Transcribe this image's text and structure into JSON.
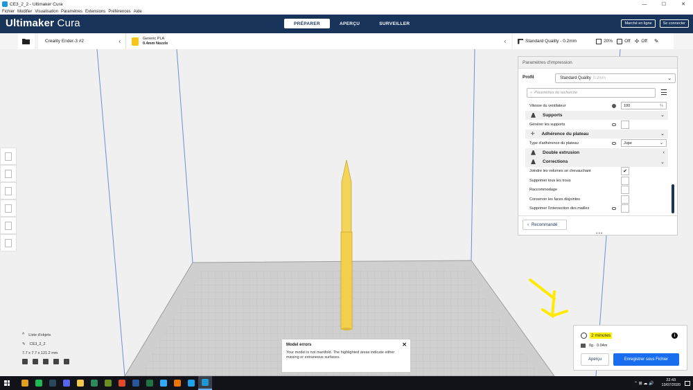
{
  "window": {
    "title": "CE3_2_2 - Ultimaker Cura",
    "controls": [
      "—",
      "☐",
      "✕"
    ]
  },
  "menu": [
    "Fichier",
    "Modifier",
    "Visualisation",
    "Paramètres",
    "Extensions",
    "Préférences",
    "Aide"
  ],
  "header": {
    "brand_bold": "Ultimaker",
    "brand_light": " Cura",
    "tabs": [
      {
        "label": "PRÉPARER",
        "active": true
      },
      {
        "label": "APERÇU",
        "active": false
      },
      {
        "label": "SURVEILLER",
        "active": false
      }
    ],
    "marketplace": "Marché en ligne",
    "signin": "Se connecter"
  },
  "stage": {
    "printer": "Creality Ender-3 #2",
    "material_name": "Generic PLA",
    "nozzle": "0.4mm Nozzle",
    "quality": "Standard Quality - 0.2mm",
    "infill": "20%",
    "support": "Off",
    "adhesion": "Off"
  },
  "panel": {
    "title": "Paramètres d'impression",
    "profile_label": "Profil",
    "profile_value": "Standard Quality",
    "profile_faded": "0.2mm",
    "search_placeholder": "Paramètres de recherche",
    "rows": {
      "fan_speed": {
        "label": "Vitesse du ventilateur",
        "value": "100",
        "unit": "%"
      },
      "supports": "Supports",
      "gen_supports": "Générer les supports",
      "adhesion": "Adhérence du plateau",
      "adhesion_type": {
        "label": "Type d'adhérence du plateau",
        "value": "Jupe"
      },
      "dual": "Double extrusion",
      "corrections": "Corrections",
      "union": "Joindre les volumes se chevauchant",
      "holes": "Supprimer tous les trous",
      "stitch": "Raccommodage",
      "disjoint": "Conserver les faces disjointes",
      "intersect": "Supprimer l'intersection des mailles"
    },
    "recommended": "Recommandé",
    "dots": "•••"
  },
  "objects": {
    "header": "Liste d'objets",
    "name": "CE3_2_2",
    "size": "7.7 x 7.7 x 121.2 mm"
  },
  "errors": {
    "title": "Model errors",
    "message": "Your model is not manifold. The highlighted areas indicate either missing or extraneous surfaces.",
    "close": "✕"
  },
  "printinfo": {
    "time": "2 minutes",
    "material": "0g · 0.04m",
    "preview": "Aperçu",
    "save": "Enregistrer sous Fichier",
    "info": "i"
  },
  "taskbar": {
    "time": "22:43",
    "date": "13/07/2020",
    "tray_icons": "⌃ ⊞ ☁ 🔊",
    "apps": [
      {
        "name": "chrome",
        "color": "#e0a020"
      },
      {
        "name": "spotify",
        "color": "#1db954"
      },
      {
        "name": "steam",
        "color": "#2a475e"
      },
      {
        "name": "discord",
        "color": "#5865f2"
      },
      {
        "name": "explorer",
        "color": "#f2c94c"
      },
      {
        "name": "app6",
        "color": "#2d8a5a"
      },
      {
        "name": "minecraft",
        "color": "#6b8e23"
      },
      {
        "name": "app8",
        "color": "#e04a2a"
      },
      {
        "name": "word",
        "color": "#2b579a"
      },
      {
        "name": "excel",
        "color": "#217346"
      },
      {
        "name": "photoshop",
        "color": "#31a8ff"
      },
      {
        "name": "blender",
        "color": "#ea7600"
      },
      {
        "name": "edge",
        "color": "#1fa2e8"
      },
      {
        "name": "cura",
        "color": "#1a98d8"
      }
    ]
  },
  "colors": {
    "header": "#19345b",
    "accent": "#196ef0",
    "model": "#f5d45a",
    "arrow": "#ffea00"
  }
}
